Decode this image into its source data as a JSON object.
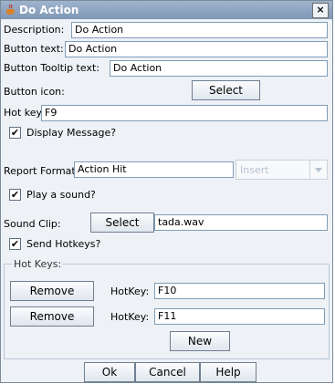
{
  "window": {
    "title": "Do Action",
    "close_glyph": "×"
  },
  "description": {
    "label": "Description:",
    "value": "Do Action"
  },
  "button_text": {
    "label": "Button text:",
    "value": "Do Action"
  },
  "tooltip": {
    "label": "Button Tooltip text:",
    "value": "Do Action"
  },
  "icon": {
    "label": "Button icon:",
    "select_label": "Select"
  },
  "hotkey": {
    "label": "Hot key:",
    "value": "F9"
  },
  "display_message": {
    "label": "Display Message?",
    "checked": true
  },
  "report_format": {
    "label": "Report Format:",
    "value": "Action Hit",
    "combo_value": "Insert"
  },
  "play_sound": {
    "label": "Play a sound?",
    "checked": true
  },
  "sound_clip": {
    "label": "Sound Clip:",
    "select_label": "Select",
    "value": "tada.wav"
  },
  "send_hotkeys": {
    "label": "Send Hotkeys?",
    "checked": true
  },
  "hotkeys_group": {
    "title": "Hot Keys:",
    "rows": [
      {
        "remove_label": "Remove",
        "key_label": "HotKey:",
        "value": "F10"
      },
      {
        "remove_label": "Remove",
        "key_label": "HotKey:",
        "value": "F11"
      }
    ],
    "new_label": "New"
  },
  "footer": {
    "ok_label": "Ok",
    "cancel_label": "Cancel",
    "help_label": "Help"
  }
}
